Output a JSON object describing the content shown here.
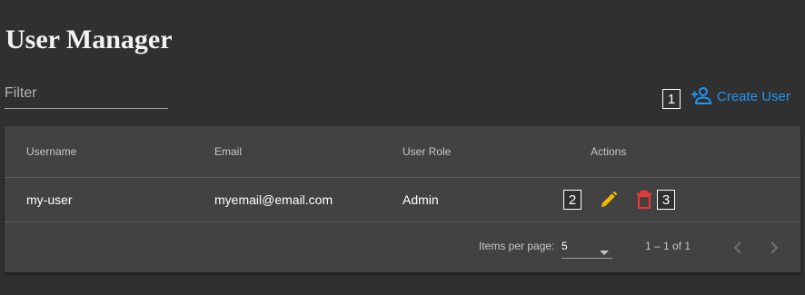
{
  "page": {
    "title": "User Manager"
  },
  "filter": {
    "placeholder": "Filter",
    "value": ""
  },
  "markers": {
    "create": "1",
    "edit": "2",
    "delete": "3"
  },
  "toolbar": {
    "create_label": "Create User",
    "create_icon": "person-add-icon"
  },
  "table": {
    "columns": [
      "Username",
      "Email",
      "User Role",
      "Actions"
    ],
    "rows": [
      {
        "username": "my-user",
        "email": "myemail@email.com",
        "role": "Admin",
        "actions": [
          "edit-icon",
          "delete-icon"
        ]
      }
    ]
  },
  "paginator": {
    "items_per_page_label": "Items per page:",
    "page_size": "5",
    "range_label": "1 – 1 of 1"
  },
  "colors": {
    "background": "#303030",
    "card": "#424242",
    "accent": "#2196f3",
    "edit": "#f5b800",
    "delete": "#e53935"
  }
}
